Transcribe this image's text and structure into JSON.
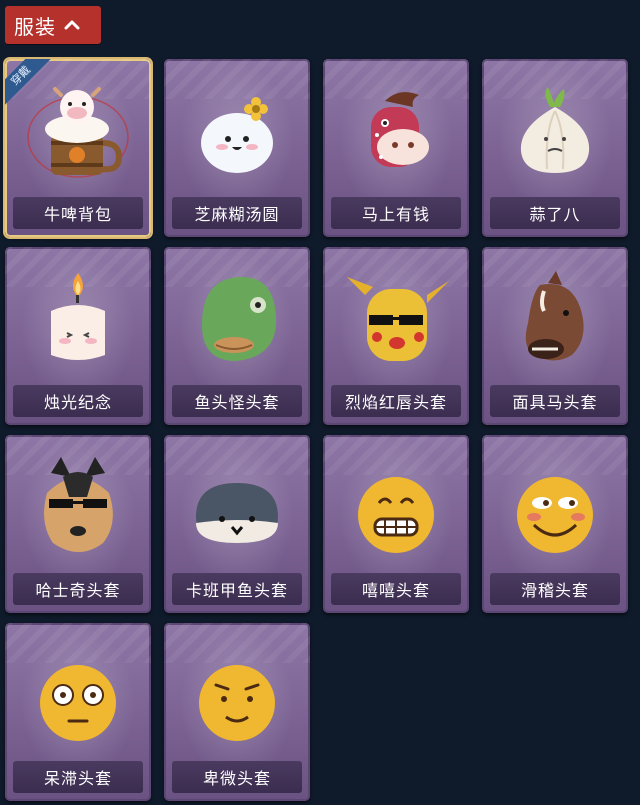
{
  "header": {
    "label": "服装"
  },
  "cards": [
    {
      "label": "牛啤背包",
      "badge": "穿戴",
      "icon": "cow-beer-backpack-icon"
    },
    {
      "label": "芝麻糊汤圆",
      "icon": "sesame-dumpling-icon"
    },
    {
      "label": "马上有钱",
      "icon": "pink-horse-icon"
    },
    {
      "label": "蒜了八",
      "icon": "garlic-icon"
    },
    {
      "label": "烛光纪念",
      "icon": "candle-icon"
    },
    {
      "label": "鱼头怪头套",
      "icon": "fish-head-mask-icon"
    },
    {
      "label": "烈焰红唇头套",
      "icon": "yellow-mouse-mask-icon"
    },
    {
      "label": "面具马头套",
      "icon": "horse-mask-icon"
    },
    {
      "label": "哈士奇头套",
      "icon": "husky-mask-icon"
    },
    {
      "label": "卡班甲鱼头套",
      "icon": "fish-mask-icon"
    },
    {
      "label": "嘻嘻头套",
      "icon": "grin-emoji-mask-icon"
    },
    {
      "label": "滑稽头套",
      "icon": "funny-emoji-mask-icon"
    },
    {
      "label": "呆滞头套",
      "icon": "dazed-emoji-mask-icon"
    },
    {
      "label": "卑微头套",
      "icon": "humble-emoji-mask-icon"
    }
  ]
}
